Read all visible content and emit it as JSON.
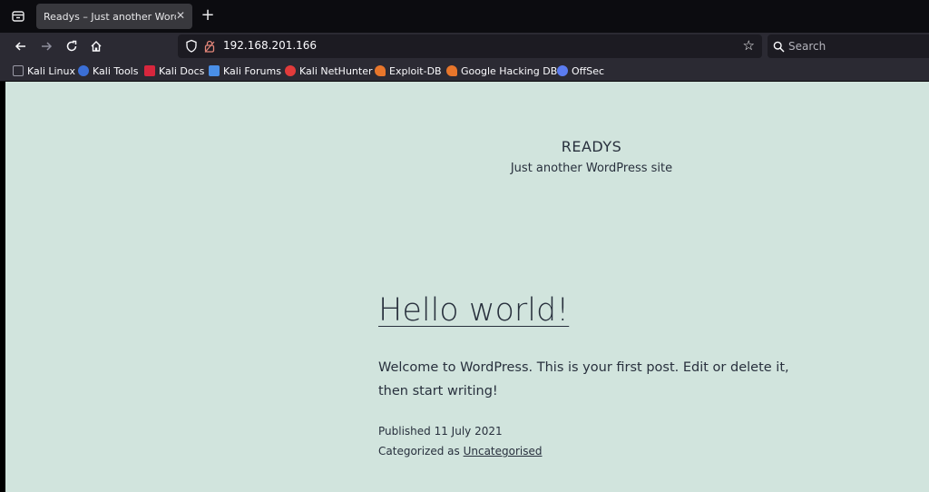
{
  "browser": {
    "tab": {
      "title": "Readys – Just another WordP"
    },
    "url": "192.168.201.166",
    "search_placeholder": "Search",
    "bookmarks": [
      {
        "label": "Kali Linux",
        "icon": "kali-dragon-icon",
        "color": "#1a1a1a"
      },
      {
        "label": "Kali Tools",
        "icon": "kali-tools-icon",
        "color": "#3b6fd6"
      },
      {
        "label": "Kali Docs",
        "icon": "kali-docs-icon",
        "color": "#d7263d"
      },
      {
        "label": "Kali Forums",
        "icon": "kali-forums-icon",
        "color": "#4a8fe7"
      },
      {
        "label": "Kali NetHunter",
        "icon": "kali-nethunter-icon",
        "color": "#e23b3b"
      },
      {
        "label": "Exploit-DB",
        "icon": "exploit-db-icon",
        "color": "#e8762b"
      },
      {
        "label": "Google Hacking DB",
        "icon": "ghdb-icon",
        "color": "#e8762b"
      },
      {
        "label": "OffSec",
        "icon": "offsec-icon",
        "color": "#5b7cf0"
      }
    ]
  },
  "page": {
    "site_title": "READYS",
    "site_description": "Just another WordPress site",
    "post": {
      "title": "Hello world!",
      "body": "Welcome to WordPress. This is your first post. Edit or delete it, then start writing!",
      "published_label": "Published 11 July 2021",
      "category_prefix": "Categorized as ",
      "category": "Uncategorised"
    }
  },
  "colors": {
    "page_bg": "#d1e4dd",
    "text": "#28303d",
    "chrome": "#2b2a33"
  }
}
